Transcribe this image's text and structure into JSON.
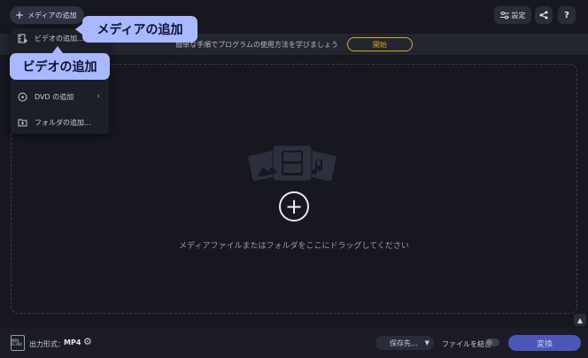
{
  "toolbar": {
    "add_media_label": "メディアの追加",
    "settings_label": "設定"
  },
  "banner": {
    "message": "簡単な手順でプログラムの使用方法を学びましょう",
    "start_label": "開始"
  },
  "menu": {
    "items": [
      {
        "label": "ビデオの追加...",
        "icon": "film-add-icon"
      },
      {
        "label": "DVD の追加",
        "icon": "dvd-icon",
        "has_submenu": true
      },
      {
        "label": "フォルダの追加...",
        "icon": "folder-add-icon"
      }
    ]
  },
  "callouts": {
    "add_media": "メディアの追加",
    "add_video": "ビデオの追加"
  },
  "dropzone": {
    "hint": "メディアファイルまたはフォルダをここにドラッグしてください"
  },
  "bottombar": {
    "format_icon_text": "MP4 H.264",
    "format_label": "出力形式：",
    "format_value": "MP4",
    "save_label": "保存先...",
    "merge_label": "ファイルを結合：",
    "convert_label": "変換"
  },
  "colors": {
    "accent_orange": "#e0a526",
    "callout_blue": "#a9b8ff",
    "convert_button": "#4b57b8",
    "background": "#16171f"
  }
}
